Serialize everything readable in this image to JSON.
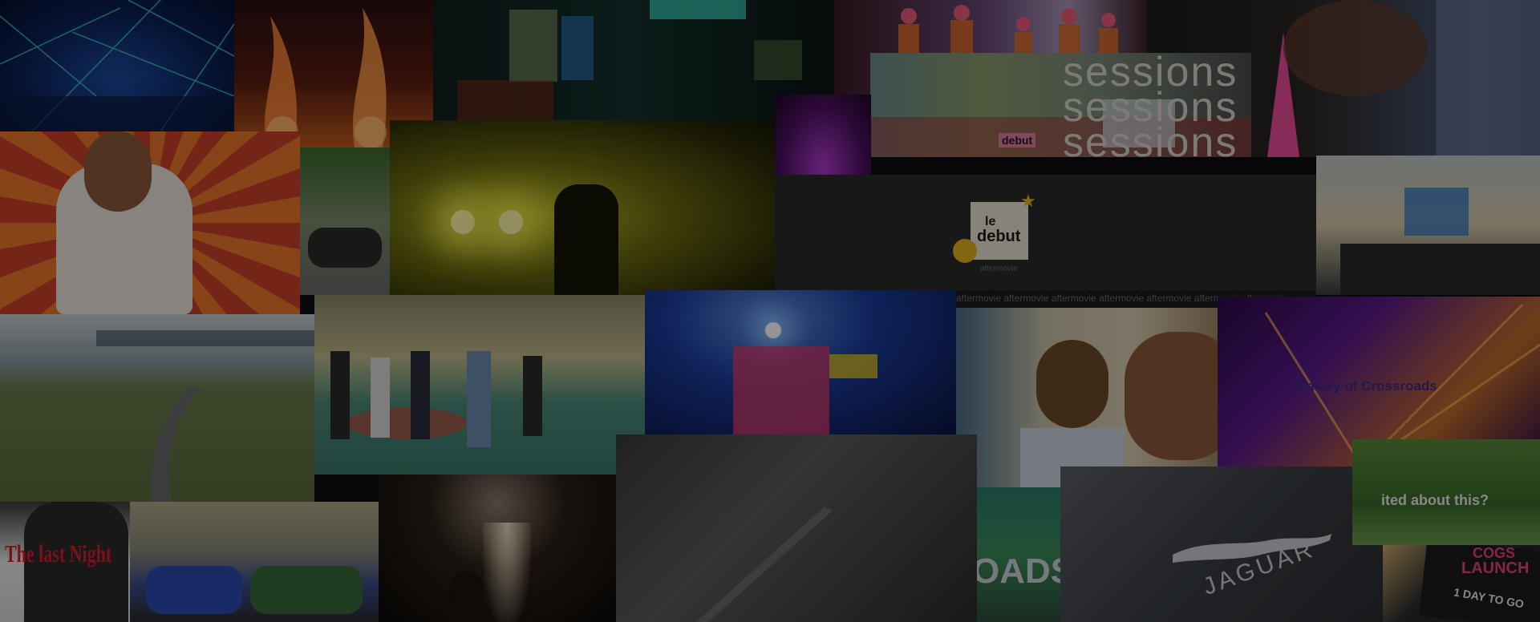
{
  "overlays": {
    "sessions": [
      "sessions",
      "sessions",
      "sessions"
    ],
    "debut_sign": "debut",
    "le_debut": {
      "line1": "le",
      "line2": "debut",
      "caption": "aftermovie"
    },
    "aftermovie_ticker": "aftermovie aftermovie aftermovie aftermovie aftermovie aftermovie aftermovie",
    "crossroads": "Galaxy of Crossroads",
    "last_night": "The last Night",
    "excited_q": "ited about this?",
    "roads": "OADS",
    "jaguar": "JAGUAR",
    "cogs": {
      "line1": "COGS",
      "line2": "LAUNCH",
      "line3": "1 DAY TO GO"
    }
  },
  "colors": {
    "page_bg": "#0d0d10",
    "sessions_text": "#d8d3cc",
    "crossroads_text": "#3a2a8a",
    "last_night_text": "#d11f2a",
    "jaguar_text": "#c9ccd1",
    "cogs_text": "#e8407a"
  }
}
